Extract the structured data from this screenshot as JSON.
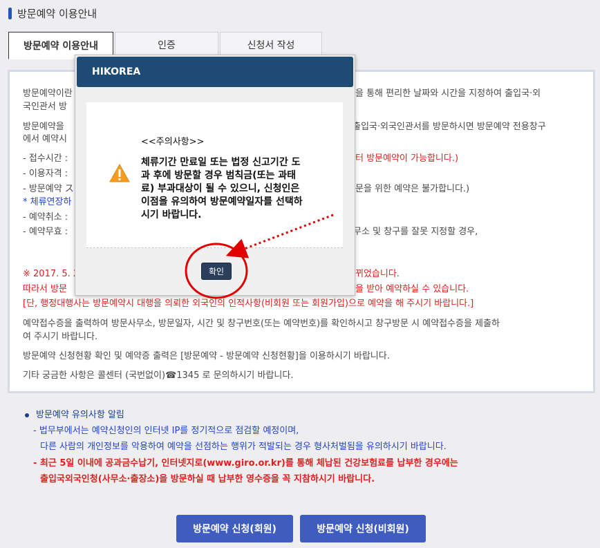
{
  "page": {
    "title": "방문예약 이용안내"
  },
  "tabs": [
    {
      "label": "방문예약 이용안내"
    },
    {
      "label": "인증"
    },
    {
      "label": "신청서 작성"
    }
  ],
  "content": {
    "lines": [
      {
        "text": "방문예약이란",
        "style": "normal"
      },
      {
        "text": "을 통해 편리한 날짜와 시간을 지정하여 출입국·외",
        "style": "normal"
      },
      {
        "text": "국인관서 방",
        "style": "normal"
      },
      {
        "text": "방문예약을",
        "style": "normal"
      },
      {
        "text": "출입국·외국인관서를 방문하시면 방문예약 전용창구",
        "style": "normal"
      },
      {
        "text": "에서 예약시",
        "style": "normal"
      },
      {
        "text": "- 접수시간 :",
        "style": "normal"
      },
      {
        "text": "터 방문예약이 가능합니다.)",
        "style": "red"
      },
      {
        "text": "- 이용자격 :",
        "style": "normal"
      },
      {
        "text": "- 방문예약 ス",
        "style": "normal"
      },
      {
        "text": "문을 위한 예약은 불가합니다.)",
        "style": "normal"
      },
      {
        "text": "* 체류연장하",
        "style": "blue"
      },
      {
        "text": "- 예약취소 :",
        "style": "normal"
      },
      {
        "text": "- 예약무효 :",
        "style": "normal"
      },
      {
        "text": "무소 및 창구를 잘못 지정할 경우,",
        "style": "normal"
      },
      {
        "text": "※ 2017. 5. 2",
        "style": "red"
      },
      {
        "text": "뀌었습니다.",
        "style": "red"
      },
      {
        "text": "따라서 방문",
        "style": "red"
      },
      {
        "text": "을 받아 예약하실 수 있습니다.",
        "style": "red"
      },
      {
        "text": "[단, 행정대행사는 방문예약시 대행을 의뢰한 외국인의 인적사항(비회원 또는 회원가입)으로 예약을 해 주시기 바랍니다.]",
        "style": "red"
      },
      {
        "text": "예약접수증을 출력하여 방문사무소, 방문일자, 시간 및 창구번호(또는 예약번호)를 확인하시고 창구방문 시 예약접수증을 제출하",
        "style": "normal"
      },
      {
        "text": "여 주시기 바랍니다.",
        "style": "normal"
      },
      {
        "text": "방문예약 신청현황 확인 및 예약증 출력은 [방문예약 - 방문예약 신청현황]을 이용하시기 바랍니다.",
        "style": "normal"
      },
      {
        "text": "기타 궁금한 사항은 콜센터 (국번없이)☎1345 로 문의하시기 바랍니다.",
        "style": "normal"
      }
    ]
  },
  "notice": {
    "title": "방문예약 유의사항 알림",
    "lines": [
      {
        "text": "- 법무부에서는 예약신청인의 인터넷 IP를 정기적으로 점검할 예정이며,",
        "style": "blue"
      },
      {
        "text": "다른 사람의 개인정보를 악용하여 예약을 선점하는 행위가 적발되는 경우 형사처벌됨을 유의하시기 바랍니다.",
        "style": "blue"
      },
      {
        "text": "- 최근 5일 이내에 공과금수납기, 인터넷지로(www.giro.or.kr)를 통해 체납된 건강보험료를 납부한 경우에는",
        "style": "red"
      },
      {
        "text": "출입국외국인청(사무소·출장소)을 방문하실 때 납부한 영수증을 꼭 지참하시기 바랍니다.",
        "style": "red"
      }
    ]
  },
  "buttons": {
    "member": "방문예약 신청(회원)",
    "nonmember": "방문예약 신청(비회원)"
  },
  "modal": {
    "header": "HIKOREA",
    "title": "<<주의사항>>",
    "message_lines": [
      "체류기간 만료일 또는 법정 신고기간 도",
      "과 후에 방문할 경우 범칙금(또는 과태",
      "료) 부과대상이 될 수 있으니, 신청인은",
      "이점을 유의하여 방문예약일자를 선택하",
      "시기 바랍니다."
    ],
    "confirm_label": "확인",
    "icon": "warning-icon"
  },
  "colors": {
    "modal_header": "#1e4b73",
    "accent_blue": "#3f5cbf",
    "warning_red": "#e02020",
    "annotation_red": "#e00000"
  }
}
